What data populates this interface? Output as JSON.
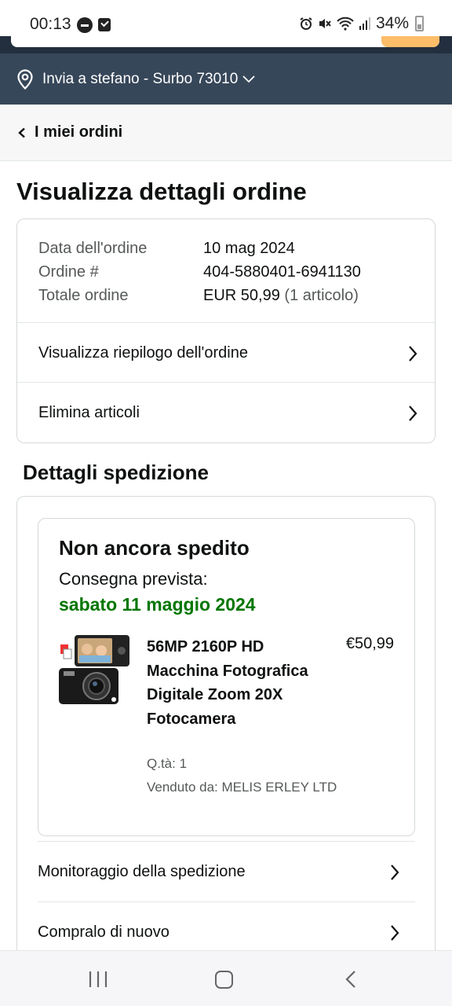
{
  "status_bar": {
    "time": "00:13",
    "battery": "34%",
    "icons": [
      "dnd-icon",
      "checkbox-notification-icon",
      "alarm-icon",
      "mute-icon",
      "wifi-icon",
      "signal-icon",
      "battery-icon"
    ]
  },
  "header": {
    "deliver_to": "Invia a stefano - Surbo 73010",
    "accent_color": "#37475a"
  },
  "nav": {
    "back_label": "I miei ordini"
  },
  "page": {
    "title": "Visualizza dettagli ordine"
  },
  "order": {
    "date_label": "Data dell'ordine",
    "date_value": "10 mag 2024",
    "number_label": "Ordine #",
    "number_value": "404-5880401-6941130",
    "total_label": "Totale ordine",
    "total_value": "EUR 50,99",
    "total_count": "(1 articolo)",
    "links": [
      "Visualizza riepilogo dell'ordine",
      "Elimina articoli"
    ]
  },
  "shipping": {
    "section_title": "Dettagli spedizione",
    "status": "Non ancora spedito",
    "expected_label": "Consegna prevista:",
    "expected_date": "sabato 11 maggio 2024",
    "expected_color": "#007600",
    "product": {
      "title": "56MP 2160P HD Macchina Fotografica Digitale Zoom 20X Fotocamera",
      "price": "€50,99",
      "qty": "Q.tà: 1",
      "seller": "Venduto da: MELIS ERLEY LTD"
    },
    "links": [
      "Monitoraggio della spedizione",
      "Compralo di nuovo"
    ]
  }
}
